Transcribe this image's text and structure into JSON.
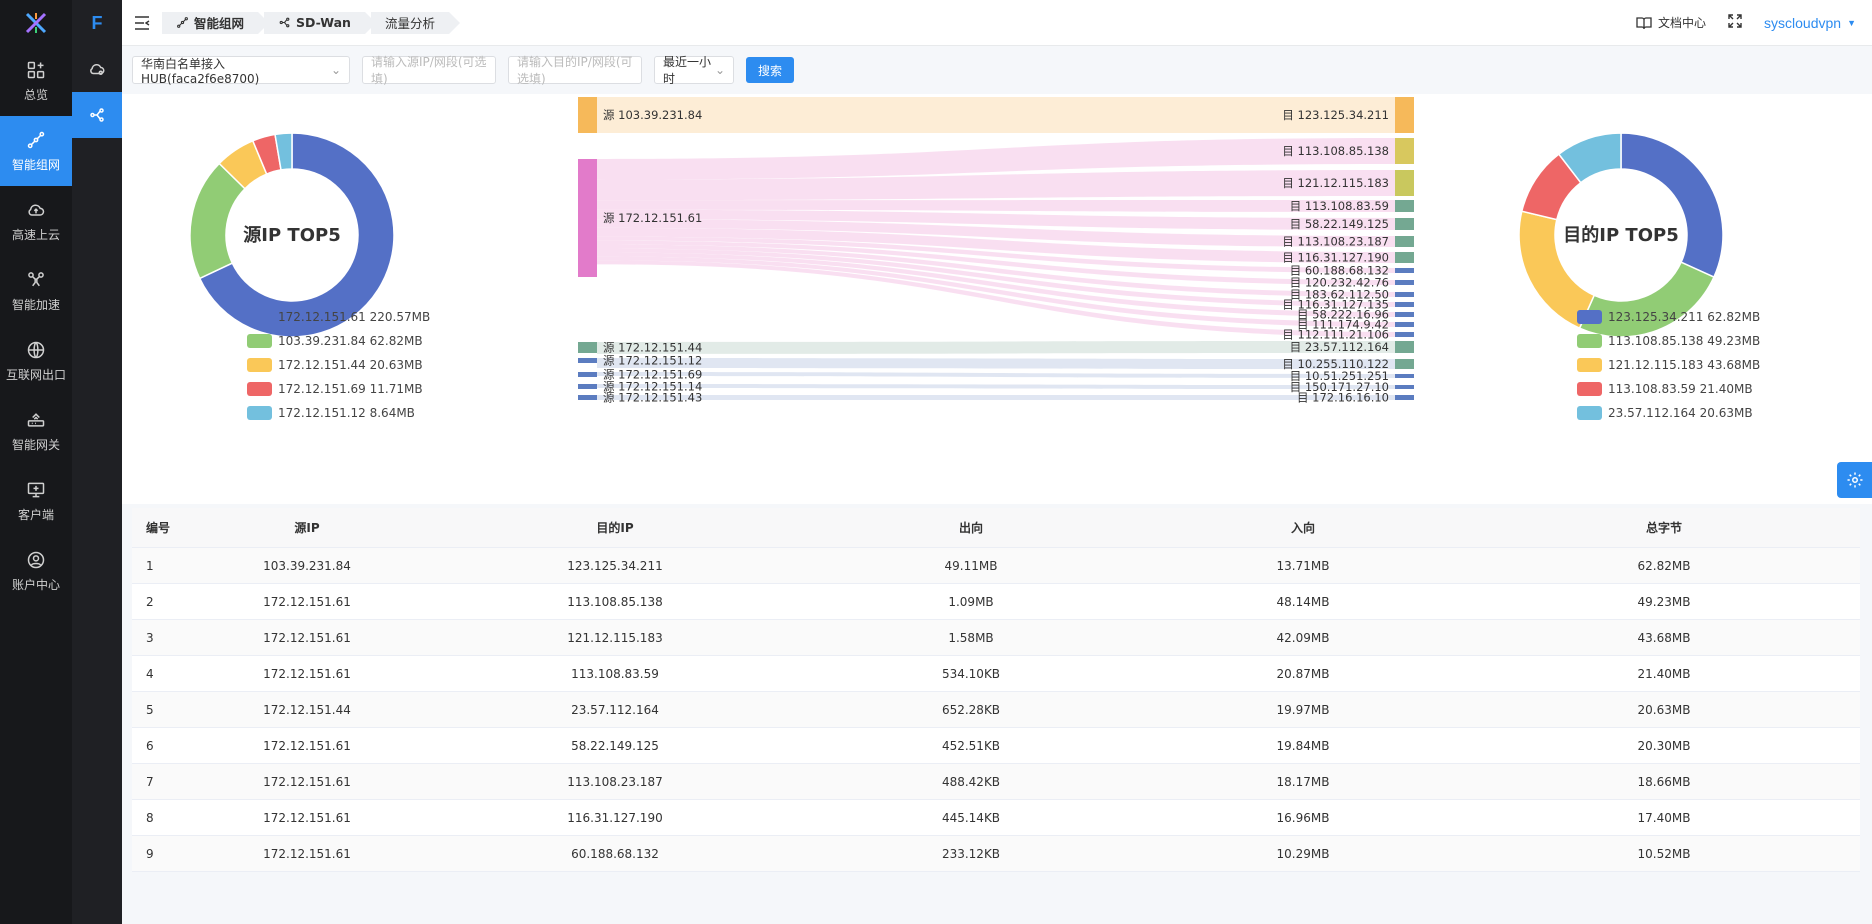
{
  "nav": {
    "items": [
      {
        "label": "总览",
        "icon": "grid-plus-icon"
      },
      {
        "label": "智能组网",
        "icon": "network-icon",
        "active": true
      },
      {
        "label": "高速上云",
        "icon": "cloud-upload-icon"
      },
      {
        "label": "智能加速",
        "icon": "drone-icon"
      },
      {
        "label": "互联网出口",
        "icon": "globe-icon"
      },
      {
        "label": "智能网关",
        "icon": "router-icon"
      },
      {
        "label": "客户端",
        "icon": "monitor-icon"
      },
      {
        "label": "账户中心",
        "icon": "user-circle-icon"
      }
    ]
  },
  "brand": "F",
  "header": {
    "breadcrumbs": [
      "智能组网",
      "SD-Wan",
      "流量分析"
    ],
    "docs_label": "文档中心",
    "user": "syscloudvpn"
  },
  "filters": {
    "hub_select": "华南白名单接入HUB(faca2f6e8700)",
    "src_placeholder": "请输入源IP/网段(可选填)",
    "dst_placeholder": "请输入目的IP/网段(可选填)",
    "time_select": "最近一小时",
    "search_label": "搜索"
  },
  "charts": {
    "colors": [
      "#5470c6",
      "#91cc75",
      "#fac858",
      "#ee6666",
      "#73c0de"
    ],
    "source_donut": {
      "title": "源IP TOP5",
      "slices": [
        {
          "label": "172.12.151.61 220.57MB",
          "value": 220.57
        },
        {
          "label": "103.39.231.84 62.82MB",
          "value": 62.82
        },
        {
          "label": "172.12.151.44 20.63MB",
          "value": 20.63
        },
        {
          "label": "172.12.151.69 11.71MB",
          "value": 11.71
        },
        {
          "label": "172.12.151.12 8.64MB",
          "value": 8.64
        }
      ]
    },
    "dest_donut": {
      "title": "目的IP TOP5",
      "slices": [
        {
          "label": "123.125.34.211 62.82MB",
          "value": 62.82
        },
        {
          "label": "113.108.85.138 49.23MB",
          "value": 49.23
        },
        {
          "label": "121.12.115.183 43.68MB",
          "value": 43.68
        },
        {
          "label": "113.108.83.59 21.40MB",
          "value": 21.4
        },
        {
          "label": "23.57.112.164 20.63MB",
          "value": 20.63
        }
      ]
    },
    "sankey": {
      "sources": [
        {
          "label": "源 103.39.231.84",
          "color": "#f6b95a"
        },
        {
          "label": "源 172.12.151.61",
          "color": "#e27bca"
        },
        {
          "label": "源 172.12.151.44",
          "color": "#74a892"
        },
        {
          "label": "源 172.12.151.12",
          "color": "#5b7cc0"
        },
        {
          "label": "源 172.12.151.69",
          "color": "#5b7cc0"
        },
        {
          "label": "源 172.12.151.14",
          "color": "#5b7cc0"
        },
        {
          "label": "源 172.12.151.43",
          "color": "#5b7cc0"
        }
      ],
      "targets": [
        {
          "label": "目 123.125.34.211",
          "src": 0,
          "color": "#f6b95a"
        },
        {
          "label": "目 113.108.85.138",
          "src": 1,
          "color": "#d8c85e"
        },
        {
          "label": "目 121.12.115.183",
          "src": 1,
          "color": "#c9c85e"
        },
        {
          "label": "目 113.108.83.59",
          "src": 1,
          "color": "#74a892"
        },
        {
          "label": "目 58.22.149.125",
          "src": 1,
          "color": "#74a892"
        },
        {
          "label": "目 113.108.23.187",
          "src": 1,
          "color": "#74a892"
        },
        {
          "label": "目 116.31.127.190",
          "src": 1,
          "color": "#74a892"
        },
        {
          "label": "目 60.188.68.132",
          "src": 1,
          "color": "#5b7cc0"
        },
        {
          "label": "目 120.232.42.76",
          "src": 1,
          "color": "#5b7cc0"
        },
        {
          "label": "目 183.62.112.50",
          "src": 1,
          "color": "#5b7cc0"
        },
        {
          "label": "目 116.31.127.135",
          "src": 1,
          "color": "#5b7cc0"
        },
        {
          "label": "目 58.222.16.96",
          "src": 1,
          "color": "#5b7cc0"
        },
        {
          "label": "目 111.174.9.42",
          "src": 1,
          "color": "#5b7cc0"
        },
        {
          "label": "目 112.111.21.106",
          "src": 1,
          "color": "#5b7cc0"
        },
        {
          "label": "目 23.57.112.164",
          "src": 2,
          "color": "#74a892"
        },
        {
          "label": "目 10.255.110.122",
          "src": 3,
          "color": "#74a892"
        },
        {
          "label": "目 10.51.251.251",
          "src": 4,
          "color": "#5b7cc0"
        },
        {
          "label": "目 150.171.27.10",
          "src": 5,
          "color": "#5b7cc0"
        },
        {
          "label": "目 172.16.16.10",
          "src": 6,
          "color": "#5b7cc0"
        }
      ]
    }
  },
  "table": {
    "headers": [
      "编号",
      "源IP",
      "目的IP",
      "出向",
      "入向",
      "总字节"
    ],
    "rows": [
      [
        "1",
        "103.39.231.84",
        "123.125.34.211",
        "49.11MB",
        "13.71MB",
        "62.82MB"
      ],
      [
        "2",
        "172.12.151.61",
        "113.108.85.138",
        "1.09MB",
        "48.14MB",
        "49.23MB"
      ],
      [
        "3",
        "172.12.151.61",
        "121.12.115.183",
        "1.58MB",
        "42.09MB",
        "43.68MB"
      ],
      [
        "4",
        "172.12.151.61",
        "113.108.83.59",
        "534.10KB",
        "20.87MB",
        "21.40MB"
      ],
      [
        "5",
        "172.12.151.44",
        "23.57.112.164",
        "652.28KB",
        "19.97MB",
        "20.63MB"
      ],
      [
        "6",
        "172.12.151.61",
        "58.22.149.125",
        "452.51KB",
        "19.84MB",
        "20.30MB"
      ],
      [
        "7",
        "172.12.151.61",
        "113.108.23.187",
        "488.42KB",
        "18.17MB",
        "18.66MB"
      ],
      [
        "8",
        "172.12.151.61",
        "116.31.127.190",
        "445.14KB",
        "16.96MB",
        "17.40MB"
      ],
      [
        "9",
        "172.12.151.61",
        "60.188.68.132",
        "233.12KB",
        "10.29MB",
        "10.52MB"
      ]
    ]
  }
}
